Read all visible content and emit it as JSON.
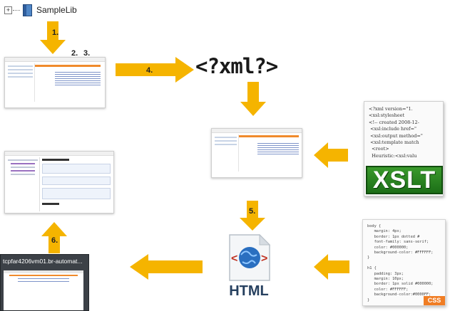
{
  "tree_node": {
    "expander": "+",
    "label": "SampleLib"
  },
  "steps": {
    "s1": "1.",
    "s2": "2.",
    "s3": "3.",
    "s4": "4.",
    "s5": "5.",
    "s6": "6."
  },
  "xml_text": "<?xml?>",
  "xslt": {
    "code": "<?xml version=\"1.\n<xsl:stylesheet\n<!-- created 2008-12-\n <xsl:include href=\"\n <xsl:output method=\"\n <xsl:template match\n  <root>\n  Heuristic:<xsl:valu",
    "badge": "XSLT"
  },
  "css": {
    "code": "body {\n   margin: 4px;\n   border: 1px dotted #\n   font-family: sans-serif;\n   color: #000000;\n   background-color: #FFFFFF;\n}\n\nh1 {\n   padding: 3px;\n   margin: 10px;\n   border: 1px solid #000000;\n   color: #FFFFFF;\n   background-color:#0000FF;\n}",
    "badge": "CSS"
  },
  "html_icon": {
    "label": "HTML"
  },
  "taskbar": {
    "title": "tcpfar4206vm01.br-automat..."
  },
  "colors": {
    "arrow": "#f5b400",
    "xslt_green": "#2b8a22",
    "css_orange": "#f07d24"
  }
}
